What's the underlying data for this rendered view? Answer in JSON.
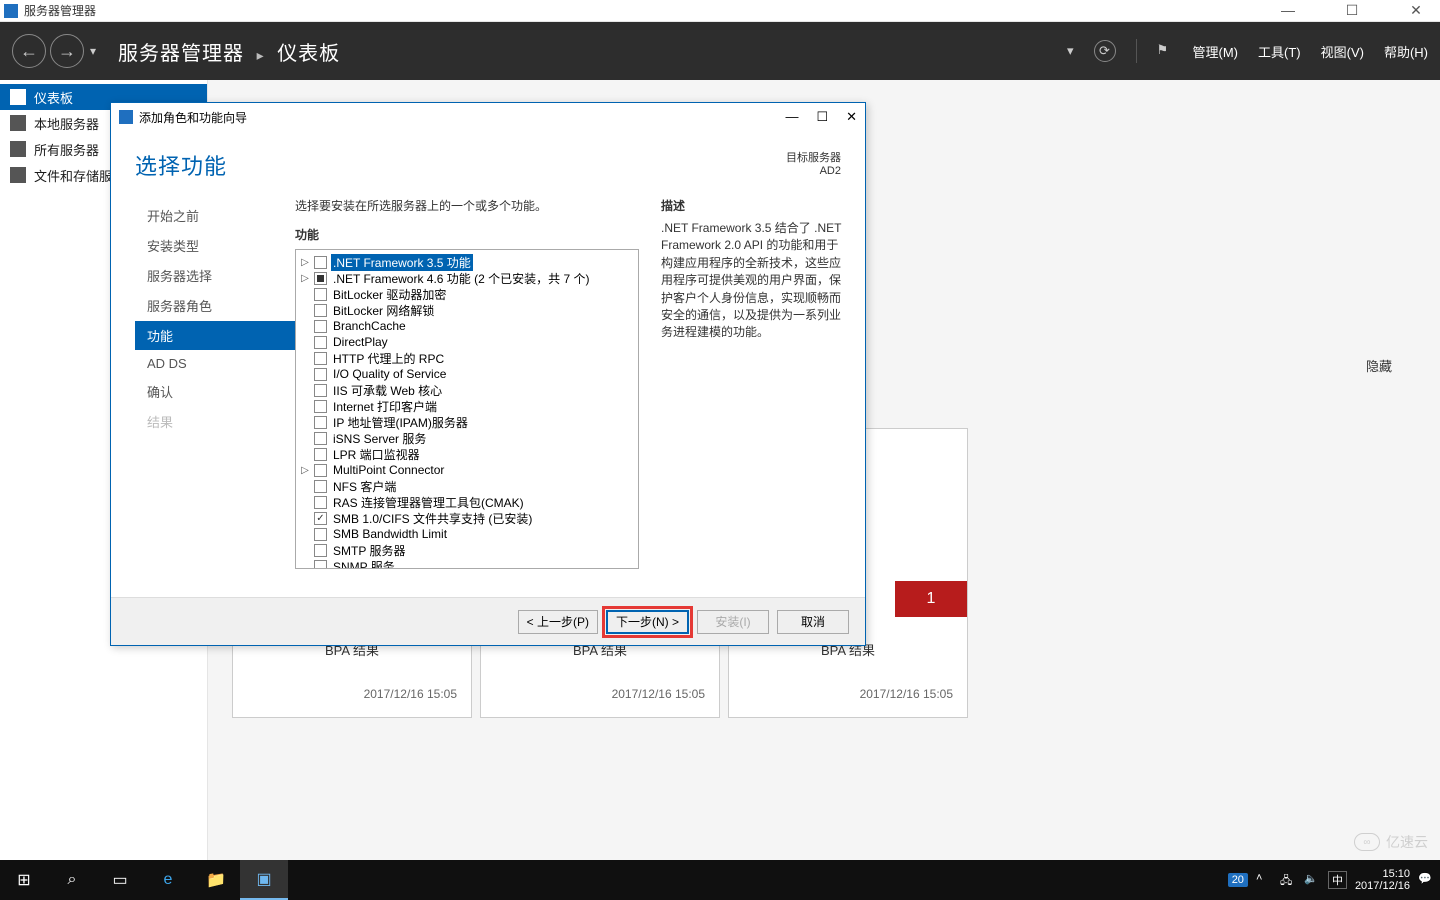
{
  "outerTitle": "服务器管理器",
  "windowControls": {
    "min": "—",
    "max": "☐",
    "close": "✕"
  },
  "breadcrumb": {
    "root": "服务器管理器",
    "page": "仪表板"
  },
  "menus": {
    "manage": "管理(M)",
    "tools": "工具(T)",
    "view": "视图(V)",
    "help": "帮助(H)"
  },
  "sidebar": {
    "items": [
      {
        "label": "仪表板",
        "active": true
      },
      {
        "label": "本地服务器"
      },
      {
        "label": "所有服务器"
      },
      {
        "label": "文件和存储服务"
      }
    ]
  },
  "hideLabel": "隐藏",
  "tiles": [
    {
      "status": "1",
      "bpa": "BPA 结果",
      "dt": "2017/12/16 15:05"
    },
    {
      "status": "",
      "bpa": "BPA 结果",
      "dt": "2017/12/16 15:05"
    }
  ],
  "wizard": {
    "title": "添加角色和功能向导",
    "heading": "选择功能",
    "targetLabel": "目标服务器",
    "targetServer": "AD2",
    "instruction": "选择要安装在所选服务器上的一个或多个功能。",
    "featuresTitle": "功能",
    "descTitle": "描述",
    "description": ".NET Framework 3.5 结合了 .NET Framework 2.0 API 的功能和用于构建应用程序的全新技术，这些应用程序可提供美观的用户界面，保护客户个人身份信息，实现顺畅而安全的通信，以及提供为一系列业务进程建模的功能。",
    "steps": [
      {
        "label": "开始之前"
      },
      {
        "label": "安装类型"
      },
      {
        "label": "服务器选择"
      },
      {
        "label": "服务器角色"
      },
      {
        "label": "功能",
        "active": true
      },
      {
        "label": "AD DS"
      },
      {
        "label": "确认"
      },
      {
        "label": "结果",
        "disabled": true
      }
    ],
    "features": [
      {
        "label": ".NET Framework 3.5 功能",
        "expandable": true,
        "selected": true
      },
      {
        "label": ".NET Framework 4.6 功能 (2 个已安装，共 7 个)",
        "expandable": true,
        "check": "filled"
      },
      {
        "label": "BitLocker 驱动器加密"
      },
      {
        "label": "BitLocker 网络解锁"
      },
      {
        "label": "BranchCache"
      },
      {
        "label": "DirectPlay"
      },
      {
        "label": "HTTP 代理上的 RPC"
      },
      {
        "label": "I/O Quality of Service"
      },
      {
        "label": "IIS 可承载 Web 核心"
      },
      {
        "label": "Internet 打印客户端"
      },
      {
        "label": "IP 地址管理(IPAM)服务器"
      },
      {
        "label": "iSNS Server 服务"
      },
      {
        "label": "LPR 端口监视器"
      },
      {
        "label": "MultiPoint Connector",
        "expandable": true
      },
      {
        "label": "NFS 客户端"
      },
      {
        "label": "RAS 连接管理器管理工具包(CMAK)"
      },
      {
        "label": "SMB 1.0/CIFS 文件共享支持 (已安装)",
        "check": "checked"
      },
      {
        "label": "SMB Bandwidth Limit"
      },
      {
        "label": "SMTP 服务器"
      },
      {
        "label": "SNMP 服务"
      }
    ],
    "buttons": {
      "prev": "< 上一步(P)",
      "next": "下一步(N) >",
      "install": "安装(I)",
      "cancel": "取消"
    }
  },
  "taskbar": {
    "time": "15:10",
    "date": "2017/12/16",
    "ime": "中",
    "badge": "20"
  },
  "watermark": "亿速云"
}
